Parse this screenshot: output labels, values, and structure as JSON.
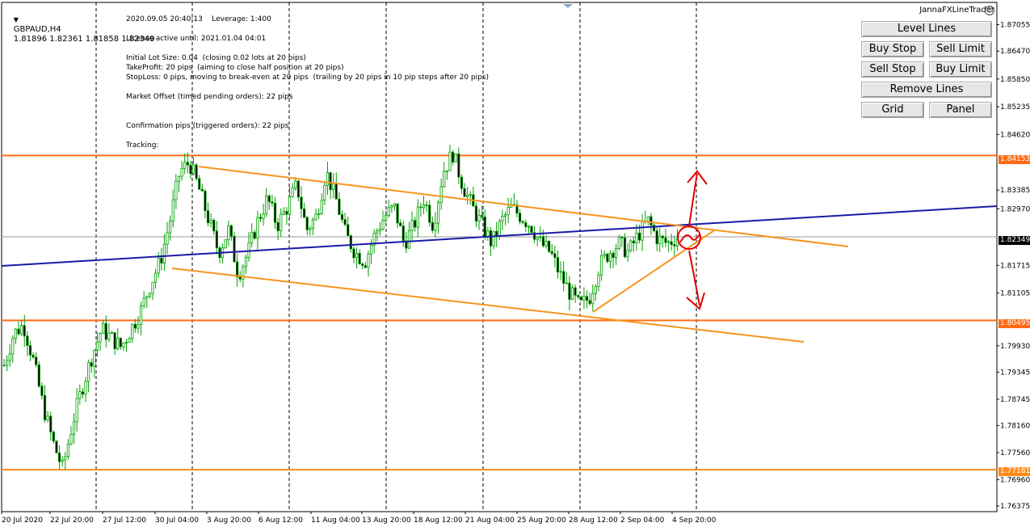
{
  "header": {
    "symbol": "GBPAUD,H4",
    "ohlc": "1.81896 1.82361 1.81858 1.82349",
    "brand": "JannaFXLineTrader"
  },
  "info": {
    "line1": "2020.09.05 20:40:13    Leverage: 1:400",
    "line2": "License active until: 2021.01.04 04:01",
    "line3": "Initial Lot Size: 0.04  (closing 0.02 lots at 20 pips)",
    "line4": "TakeProfit: 20 pips  (aiming to close half position at 20 pips)",
    "line5": "StopLoss: 0 pips, moving to break-even at 20 pips  (trailing by 20 pips in 10 pip steps after 20 pips)",
    "line6": "Market Offset (timed pending orders): 22 pips",
    "line7": "Confirmation pips (triggered orders): 22 pips",
    "line8": "Tracking:"
  },
  "panel": {
    "level_lines": "Level Lines",
    "buy_stop": "Buy Stop",
    "sell_limit": "Sell Limit",
    "sell_stop": "Sell Stop",
    "buy_limit": "Buy Limit",
    "remove_lines": "Remove Lines",
    "grid": "Grid",
    "panel": "Panel"
  },
  "price_tags": {
    "upper": "1.84153",
    "current": "1.82349",
    "middle": "1.80495",
    "lower": "1.77181"
  },
  "colors": {
    "candle": "#00a000",
    "channel": "#f7941d",
    "trend_blue": "#1a1aa8",
    "level_orange": "#ff6a13",
    "level_lower": "#ff8c1a",
    "annotation": "#e30000"
  },
  "chart_data": {
    "type": "candlestick",
    "symbol": "GBPAUD",
    "timeframe": "H4",
    "y_ticks": [
      "1.87055",
      "1.86470",
      "1.85850",
      "1.85235",
      "1.84620",
      "1.84153",
      "1.83385",
      "1.82970",
      "1.82349",
      "1.81715",
      "1.81105",
      "1.80495",
      "1.79930",
      "1.79345",
      "1.78745",
      "1.78160",
      "1.77560",
      "1.77181",
      "1.76960",
      "1.76375"
    ],
    "x_ticks": [
      "20 Jul 2020",
      "22 Jul 20:00",
      "27 Jul 12:00",
      "30 Jul 04:00",
      "3 Aug 20:00",
      "6 Aug 12:00",
      "11 Aug 04:00",
      "13 Aug 20:00",
      "18 Aug 12:00",
      "21 Aug 04:00",
      "25 Aug 20:00",
      "28 Aug 12:00",
      "2 Sep 04:00",
      "4 Sep 20:00"
    ],
    "ylim": [
      1.7625,
      1.8755
    ],
    "levels": [
      1.84153,
      1.80495,
      1.77181
    ],
    "current_price": 1.82349,
    "close_path": [
      1.795,
      1.802,
      1.804,
      1.796,
      1.786,
      1.778,
      1.772,
      1.782,
      1.79,
      1.797,
      1.803,
      1.801,
      1.799,
      1.803,
      1.807,
      1.813,
      1.818,
      1.827,
      1.838,
      1.84,
      1.834,
      1.827,
      1.82,
      1.825,
      1.815,
      1.82,
      1.827,
      1.832,
      1.826,
      1.83,
      1.835,
      1.825,
      1.828,
      1.838,
      1.832,
      1.824,
      1.82,
      1.818,
      1.824,
      1.828,
      1.83,
      1.822,
      1.826,
      1.832,
      1.826,
      1.838,
      1.842,
      1.835,
      1.83,
      1.826,
      1.822,
      1.827,
      1.83,
      1.828,
      1.826,
      1.822,
      1.82,
      1.815,
      1.811,
      1.808,
      1.81,
      1.817,
      1.82,
      1.822,
      1.82,
      1.824,
      1.827,
      1.823,
      1.822,
      1.8235
    ]
  }
}
